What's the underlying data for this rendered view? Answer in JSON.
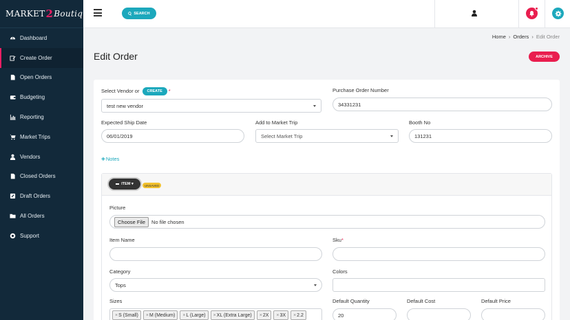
{
  "brand": {
    "pre": "MARKET",
    "two": "2",
    "post": "Boutique"
  },
  "sidebar": {
    "items": [
      {
        "label": "Dashboard",
        "icon": "dashboard-icon"
      },
      {
        "label": "Create Order",
        "icon": "edit-icon"
      },
      {
        "label": "Open Orders",
        "icon": "file-icon"
      },
      {
        "label": "Budgeting",
        "icon": "wallet-icon"
      },
      {
        "label": "Reporting",
        "icon": "chart-icon"
      },
      {
        "label": "Market Trips",
        "icon": "cart-icon"
      },
      {
        "label": "Vendors",
        "icon": "user-icon"
      },
      {
        "label": "Closed Orders",
        "icon": "file-icon"
      },
      {
        "label": "Draft Orders",
        "icon": "edit-box-icon"
      },
      {
        "label": "All Orders",
        "icon": "folder-icon"
      },
      {
        "label": "Support",
        "icon": "lifebuoy-icon"
      }
    ],
    "active_index": 1
  },
  "topbar": {
    "search_label": "SEARCH"
  },
  "breadcrumb": {
    "home": "Home",
    "orders": "Orders",
    "current": "Edit Order"
  },
  "page": {
    "title": "Edit Order",
    "archive_label": "ARCHIVE"
  },
  "form": {
    "vendor_label": "Select Vendor or",
    "create_label": "CREATE",
    "vendor_value": "test new vendor",
    "po_label": "Purchase Order Number",
    "po_value": "34331231",
    "ship_label": "Expected Ship Date",
    "ship_value": "06/01/2019",
    "trip_label": "Add to Market Trip",
    "trip_placeholder": "Select Market Trip",
    "booth_label": "Booth No",
    "booth_value": "131231",
    "notes_label": "Notes"
  },
  "item": {
    "toggle_label": "ITEM",
    "status_badge": "UNSAVED",
    "picture_label": "Picture",
    "file_button": "Choose File",
    "file_status": "No file chosen",
    "name_label": "Item Name",
    "sku_label": "Sku",
    "category_label": "Category",
    "category_value": "Tops",
    "colors_label": "Colors",
    "sizes_label": "Sizes",
    "sizes": [
      "S (Small)",
      "M (Medium)",
      "L (Large)",
      "XL (Extra Large)",
      "2X",
      "3X",
      "2.2"
    ],
    "qty_label": "Default Quantity",
    "qty_value": "20",
    "cost_label": "Default Cost",
    "price_label": "Default Price"
  }
}
